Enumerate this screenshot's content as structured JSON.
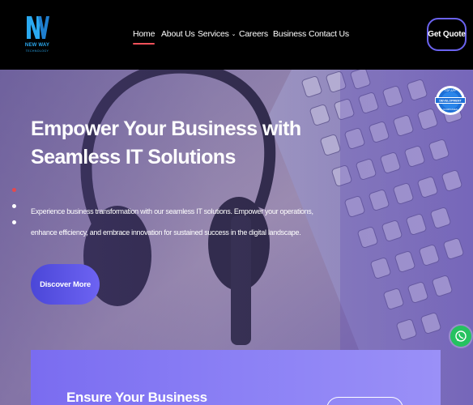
{
  "brand": {
    "name": "NEW WAY",
    "tagline": "TECHNOLOGY"
  },
  "nav": {
    "items": [
      {
        "label": "Home",
        "active": true
      },
      {
        "label": "About Us",
        "active": false
      },
      {
        "label": "Services",
        "active": false,
        "dropdown": true
      },
      {
        "label": "Careers",
        "active": false
      },
      {
        "label": "Business",
        "active": false
      },
      {
        "label": "Contact Us",
        "active": false
      }
    ],
    "quote_label": "Get Quote"
  },
  "hero": {
    "title_line1": "Empower Your Business with",
    "title_line2": "Seamless IT Solutions",
    "desc_line1": "Experience business transformation with our seamless IT solutions. Empower your operations,",
    "desc_line2": "enhance efficiency, and embrace innovation for sustained success in the digital landscape.",
    "cta_label": "Discover More",
    "slider_active_index": 0,
    "slider_count": 3
  },
  "badge": {
    "line1": "TOP APP",
    "line2": "DEVELOPMENT",
    "line3": "COMPANIES"
  },
  "card": {
    "title": "Ensure Your Business"
  },
  "colors": {
    "header_bg": "#000000",
    "accent": "#6b63f0",
    "nav_active_underline": "#f0515a",
    "whatsapp": "#25c260"
  },
  "icons": [
    "logo-mark-icon",
    "chevron-down-icon",
    "whatsapp-icon",
    "award-badge-icon"
  ]
}
